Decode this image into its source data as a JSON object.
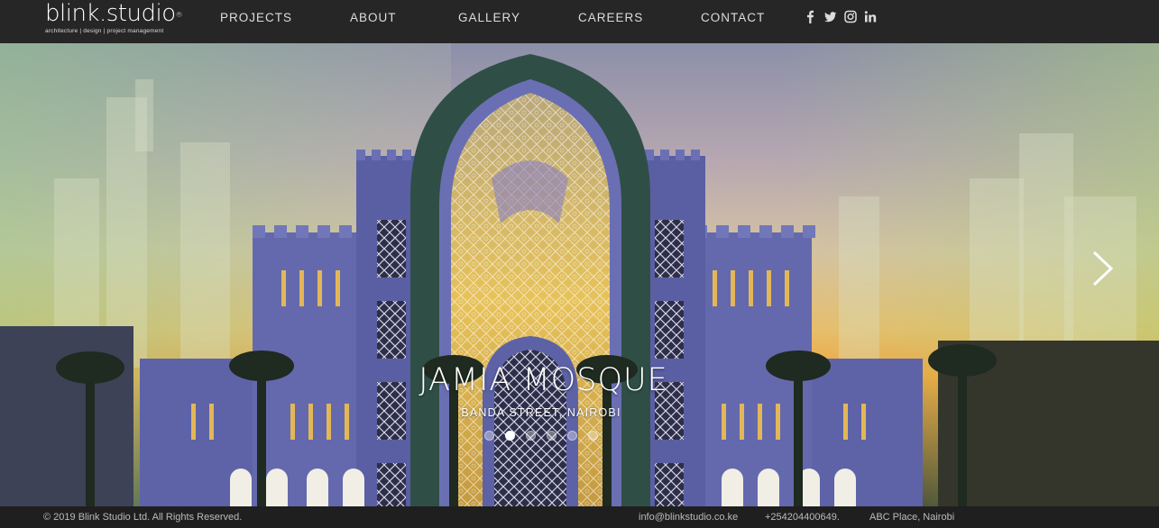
{
  "brand": {
    "name": "blink.studio",
    "registered": "®",
    "tagline": "architecture | design | project management"
  },
  "nav": {
    "items": [
      {
        "label": "PROJECTS"
      },
      {
        "label": "ABOUT"
      },
      {
        "label": "GALLERY"
      },
      {
        "label": "CAREERS"
      },
      {
        "label": "CONTACT"
      }
    ],
    "social": [
      "facebook-icon",
      "twitter-icon",
      "instagram-icon",
      "linkedin-icon"
    ]
  },
  "hero": {
    "title": "JAMIA MOSQUE",
    "subtitle": "BANDA STREET, NAIROBI",
    "slide_count": 6,
    "active_slide": 2
  },
  "footer": {
    "copyright": "© 2019 Blink Studio Ltd. All Rights Reserved.",
    "email": "info@blinkstudio.co.ke",
    "phone": "+254204400649.",
    "address": "ABC Place, Nairobi"
  },
  "colors": {
    "header_bg": "#262626",
    "text_light": "#dddddd"
  }
}
